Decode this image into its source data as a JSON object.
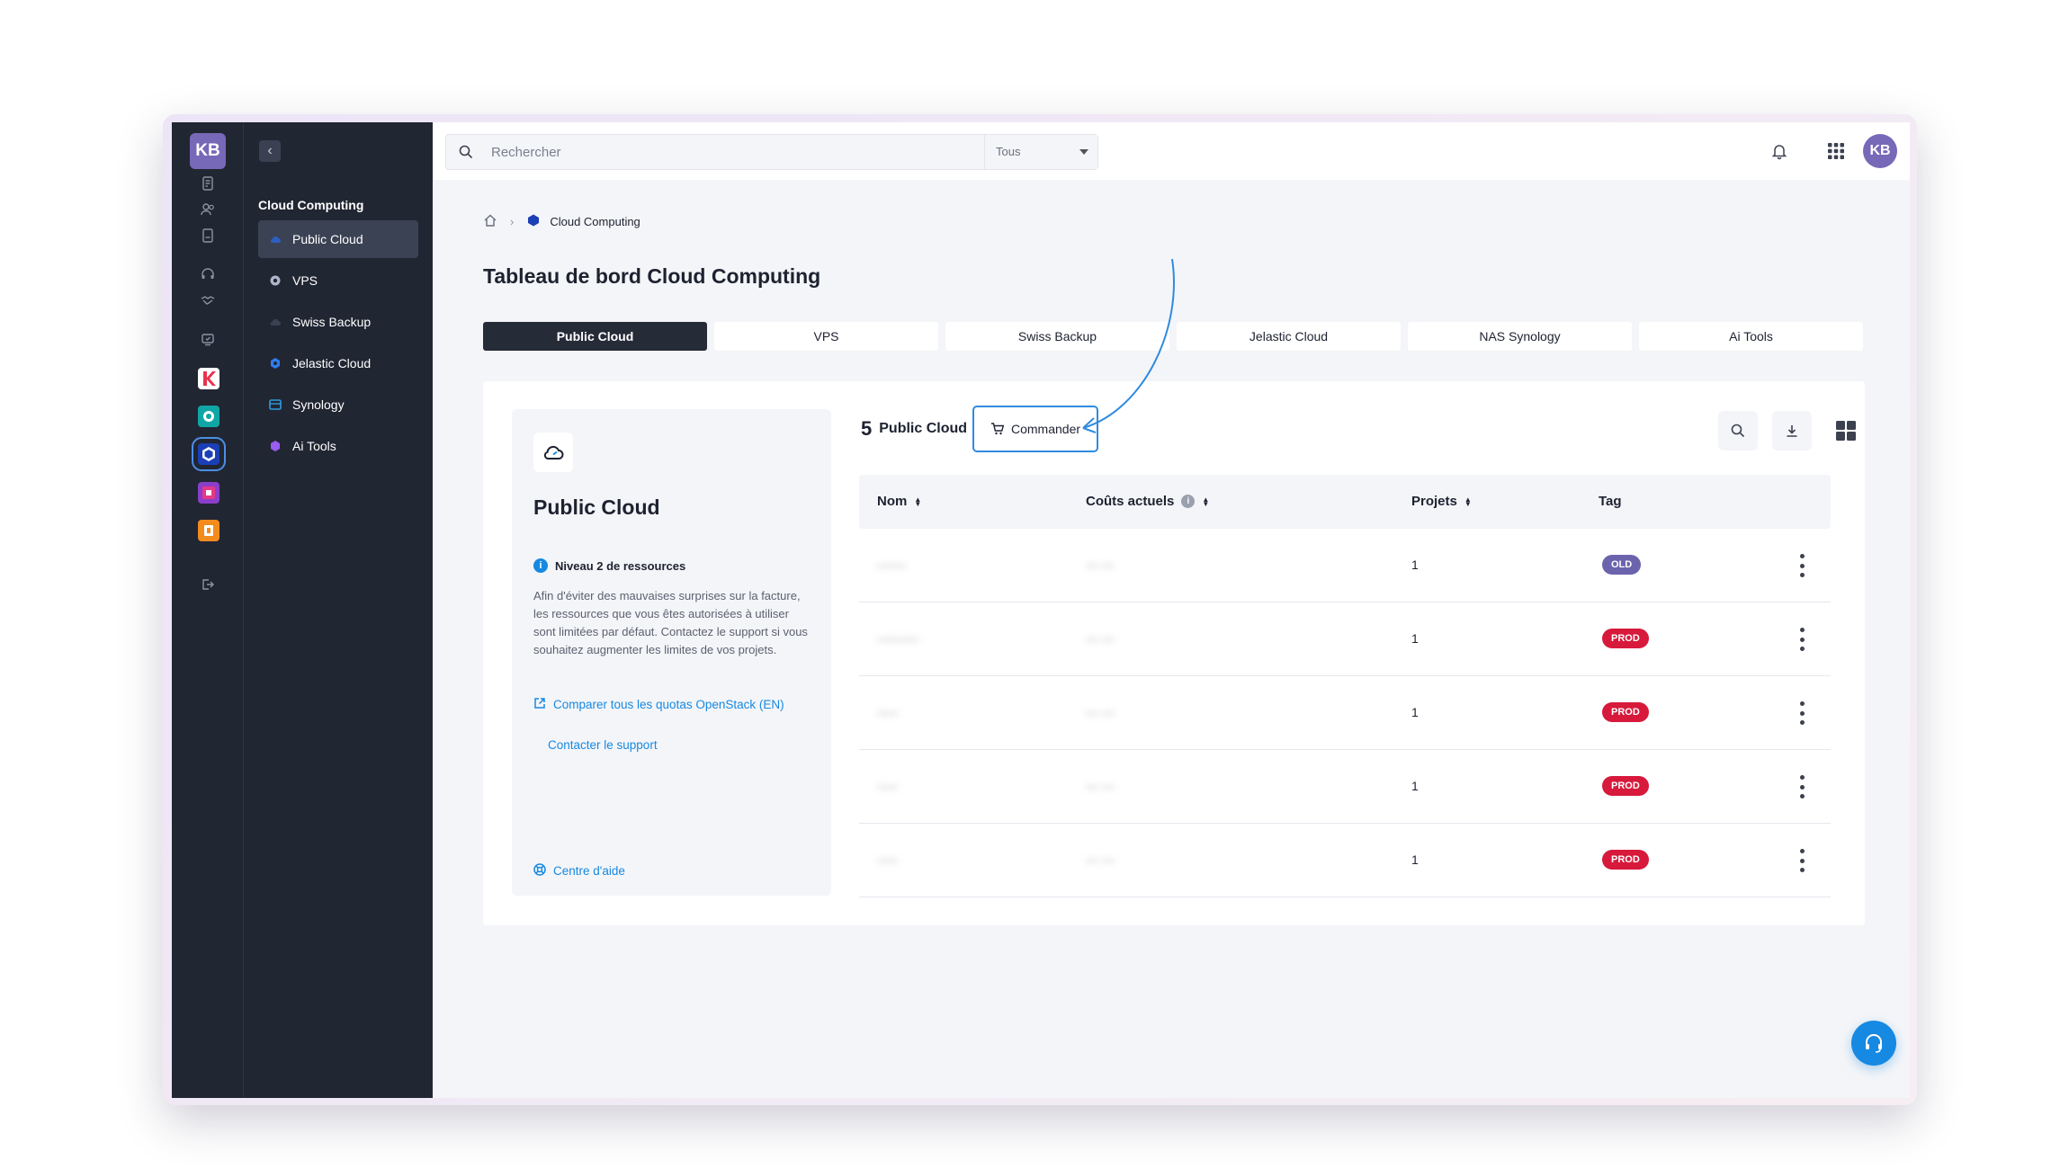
{
  "user": {
    "initials": "KB"
  },
  "sidebar": {
    "section": "Cloud Computing",
    "items": [
      {
        "label": "Public Cloud",
        "icon": "cloud-icon",
        "active": true
      },
      {
        "label": "VPS",
        "icon": "server-icon"
      },
      {
        "label": "Swiss Backup",
        "icon": "backup-cloud-icon"
      },
      {
        "label": "Jelastic Cloud",
        "icon": "jelastic-icon"
      },
      {
        "label": "Synology",
        "icon": "synology-icon"
      },
      {
        "label": "Ai Tools",
        "icon": "ai-tools-icon"
      }
    ]
  },
  "search": {
    "placeholder": "Rechercher",
    "scope": "Tous"
  },
  "breadcrumb": {
    "current": "Cloud Computing"
  },
  "page": {
    "title": "Tableau de bord Cloud Computing"
  },
  "tabs": [
    "Public Cloud",
    "VPS",
    "Swiss Backup",
    "Jelastic Cloud",
    "NAS Synology",
    "Ai Tools"
  ],
  "info": {
    "title": "Public Cloud",
    "level": "Niveau 2 de ressources",
    "description": "Afin d'éviter des mauvaises surprises sur la facture, les ressources que vous êtes autorisées à utiliser sont limitées par défaut. Contactez le support si vous souhaitez augmenter les limites de vos projets.",
    "compare_link": "Comparer tous les quotas OpenStack (EN)",
    "support_link": "Contacter le support",
    "help_link": "Centre d'aide"
  },
  "list": {
    "count": "5",
    "count_label": "Public Cloud",
    "order_button": "Commander",
    "columns": [
      "Nom",
      "Coûts actuels",
      "Projets",
      "Tag"
    ],
    "rows": [
      {
        "name": "-------",
        "cost": "--- ---",
        "projects": "1",
        "tag": "OLD"
      },
      {
        "name": "----------",
        "cost": "--- ---",
        "projects": "1",
        "tag": "PROD"
      },
      {
        "name": "-----",
        "cost": "--- ---",
        "projects": "1",
        "tag": "PROD"
      },
      {
        "name": "-----",
        "cost": "--- ---",
        "projects": "1",
        "tag": "PROD"
      },
      {
        "name": "-----",
        "cost": "--- ---",
        "projects": "1",
        "tag": "PROD"
      }
    ]
  },
  "colors": {
    "accent": "#1689e2",
    "sidebar_bg": "#212633",
    "old_badge": "#6c63ad",
    "prod_badge": "#d7193b",
    "brand_avatar": "#7768b8"
  }
}
